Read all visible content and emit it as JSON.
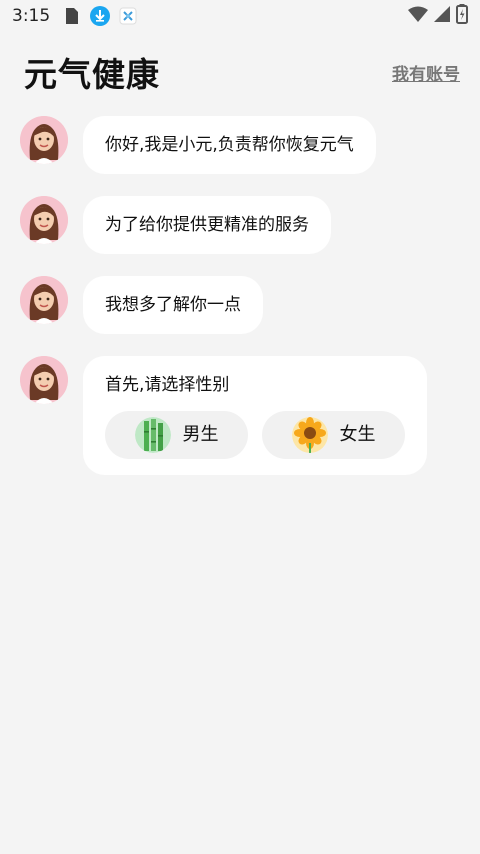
{
  "status_bar": {
    "time": "3:15",
    "icons": [
      "sim-card-icon",
      "download-icon",
      "app-notification-icon",
      "wifi-icon",
      "cellular-signal-icon",
      "battery-charging-icon"
    ]
  },
  "header": {
    "title": "元气健康",
    "account_link": "我有账号"
  },
  "messages": [
    {
      "text": "你好,我是小元,负责帮你恢复元气"
    },
    {
      "text": "为了给你提供更精准的服务"
    },
    {
      "text": "我想多了解你一点"
    },
    {
      "text": "首先,请选择性别"
    }
  ],
  "gender_options": [
    {
      "label": "男生",
      "icon": "bamboo-icon"
    },
    {
      "label": "女生",
      "icon": "sunflower-icon"
    }
  ],
  "colors": {
    "background": "#f4f4f4",
    "bubble": "#ffffff",
    "option_bg": "#f1f1f1",
    "avatar_bg": "#f6c3cd",
    "download_icon": "#1aa6f0",
    "account_link": "#777777"
  }
}
